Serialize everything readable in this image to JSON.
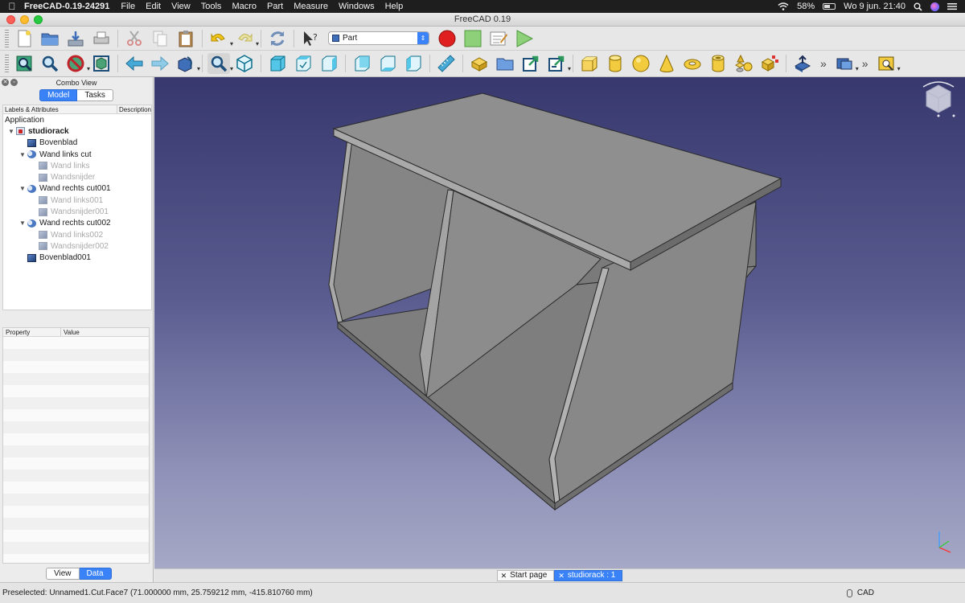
{
  "menubar": {
    "app_name": "FreeCAD-0.19-24291",
    "menus": [
      "File",
      "Edit",
      "View",
      "Tools",
      "Macro",
      "Part",
      "Measure",
      "Windows",
      "Help"
    ],
    "battery": "58%",
    "clock": "Wo 9 jun.  21:40"
  },
  "window": {
    "title": "FreeCAD 0.19"
  },
  "toolbar": {
    "workbench": "Part",
    "more_label": "»"
  },
  "combo_view": {
    "title": "Combo View",
    "tabs": [
      "Model",
      "Tasks"
    ],
    "active_tab": "Model",
    "tree_columns": [
      "Labels & Attributes",
      "Description"
    ],
    "tree_root": "Application",
    "tree_items": [
      {
        "label": "studiorack",
        "level": 0,
        "type": "doc",
        "expanded": true,
        "bold": true,
        "dim": false
      },
      {
        "label": "Bovenblad",
        "level": 1,
        "type": "part",
        "expanded": null,
        "bold": false,
        "dim": false
      },
      {
        "label": "Wand links cut",
        "level": 1,
        "type": "cut",
        "expanded": true,
        "bold": false,
        "dim": false
      },
      {
        "label": "Wand links",
        "level": 2,
        "type": "part",
        "expanded": null,
        "bold": false,
        "dim": true
      },
      {
        "label": "Wandsnijder",
        "level": 2,
        "type": "part",
        "expanded": null,
        "bold": false,
        "dim": true
      },
      {
        "label": "Wand rechts cut001",
        "level": 1,
        "type": "cut",
        "expanded": true,
        "bold": false,
        "dim": false
      },
      {
        "label": "Wand links001",
        "level": 2,
        "type": "part",
        "expanded": null,
        "bold": false,
        "dim": true
      },
      {
        "label": "Wandsnijder001",
        "level": 2,
        "type": "part",
        "expanded": null,
        "bold": false,
        "dim": true
      },
      {
        "label": "Wand rechts cut002",
        "level": 1,
        "type": "cut",
        "expanded": true,
        "bold": false,
        "dim": false
      },
      {
        "label": "Wand links002",
        "level": 2,
        "type": "part",
        "expanded": null,
        "bold": false,
        "dim": true
      },
      {
        "label": "Wandsnijder002",
        "level": 2,
        "type": "part",
        "expanded": null,
        "bold": false,
        "dim": true
      },
      {
        "label": "Bovenblad001",
        "level": 1,
        "type": "part",
        "expanded": null,
        "bold": false,
        "dim": false
      }
    ],
    "property_columns": [
      "Property",
      "Value"
    ],
    "bottom_tabs": [
      "View",
      "Data"
    ],
    "active_bottom_tab": "Data"
  },
  "document_tabs": [
    {
      "label": "Start page",
      "active": false
    },
    {
      "label": "studiorack : 1",
      "active": true
    }
  ],
  "statusbar": {
    "message": "Preselected: Unnamed1.Cut.Face7 (71.000000 mm, 25.759212 mm, -415.810760 mm)",
    "nav_style": "CAD"
  },
  "colors": {
    "accent": "#3a82f7",
    "viewport_top": "#37386e",
    "viewport_bottom": "#a6a8c6",
    "model_face": "#8a8a8a"
  }
}
